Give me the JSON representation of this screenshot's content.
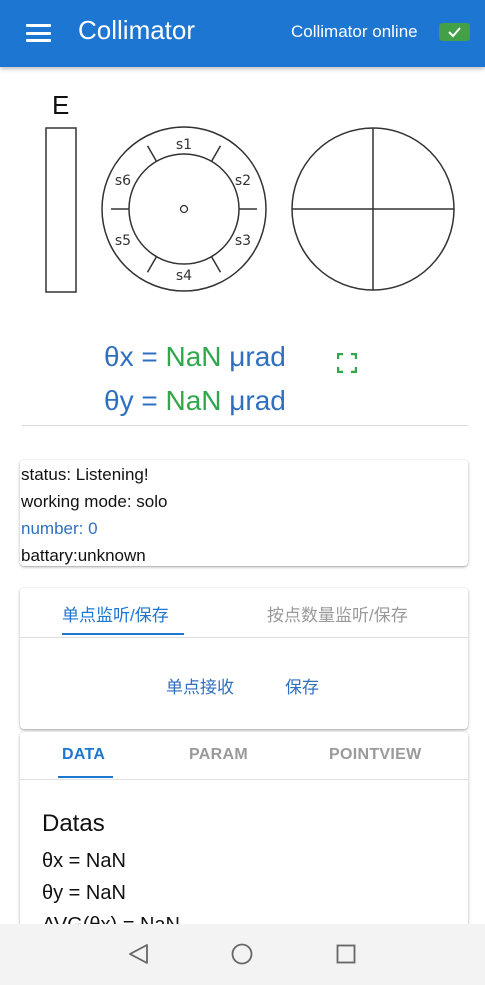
{
  "appbar": {
    "title": "Collimator",
    "status_text": "Collimator online",
    "menu_icon": "hamburger-menu-icon",
    "status_icon": "check-icon"
  },
  "diagram": {
    "edge_label": "E",
    "sensor_labels": [
      "s1",
      "s2",
      "s3",
      "s4",
      "s5",
      "s6"
    ]
  },
  "readout": {
    "theta_x_label": "θx = ",
    "theta_x_value": "NaN",
    "theta_y_label": "θy = ",
    "theta_y_value": "NaN",
    "unit": "μrad",
    "fullscreen_icon": "fullscreen-icon"
  },
  "status": {
    "status_line": "status: Listening!",
    "mode_line": "working mode: solo",
    "number_line": "number: 0",
    "battery_line": "battary:unknown"
  },
  "tabs1": {
    "tab_single": "单点监听/保存",
    "tab_count": "按点数量监听/保存",
    "receive_button": "单点接收",
    "save_button": "保存"
  },
  "tabs2": {
    "tab_data": "DATA",
    "tab_param": "PARAM",
    "tab_pointview": "POINTVIEW",
    "datas_title": "Datas",
    "lines": [
      "θx = NaN",
      "θy = NaN",
      "AVG(θx) = NaN"
    ]
  },
  "navbar": {
    "back_icon": "back-triangle-icon",
    "home_icon": "home-circle-icon",
    "recents_icon": "recents-square-icon"
  },
  "colors": {
    "primary": "#1c76d2",
    "value_green": "#2ea84b",
    "label_blue": "#2f6fc0",
    "badge_green": "#43a047"
  }
}
